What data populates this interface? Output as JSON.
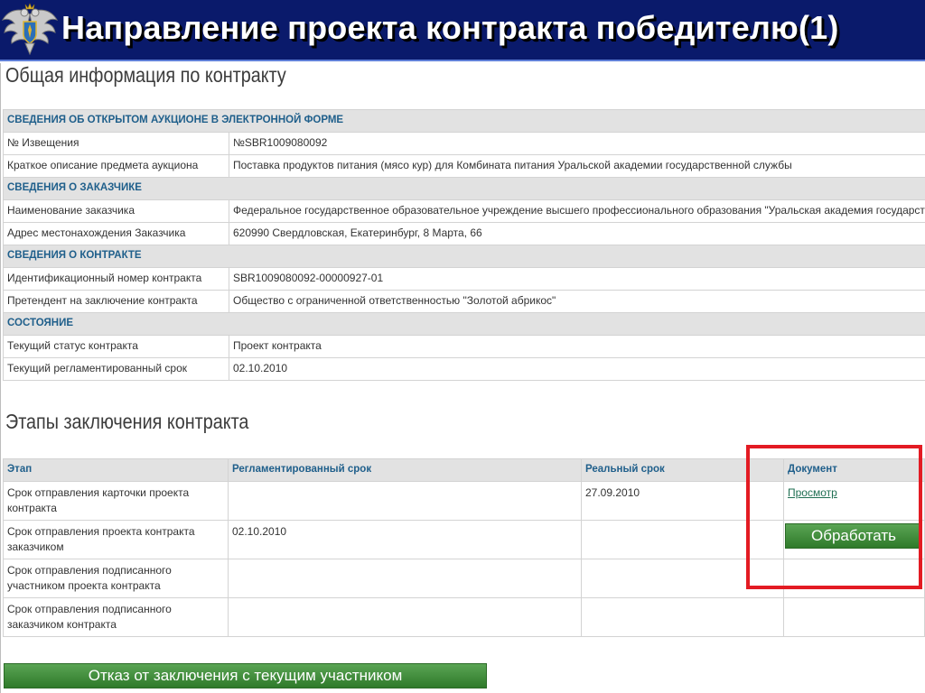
{
  "header": {
    "title": "Направление проекта контракта победителю(1)",
    "emblem_icon": "double-headed-eagle-emblem"
  },
  "general": {
    "heading": "Общая информация по контракту",
    "sections": [
      {
        "title": "СВЕДЕНИЯ ОБ ОТКРЫТОМ АУКЦИОНЕ В ЭЛЕКТРОННОЙ ФОРМЕ",
        "rows": [
          {
            "label": "№ Извещения",
            "value": "№SBR1009080092"
          },
          {
            "label": "Краткое описание предмета аукциона",
            "value": "Поставка продуктов питания (мясо кур) для Комбината питания Уральской академии государственной службы"
          }
        ]
      },
      {
        "title": "СВЕДЕНИЯ О ЗАКАЗЧИКЕ",
        "rows": [
          {
            "label": "Наименование заказчика",
            "value": "Федеральное государственное образовательное учреждение высшего профессионального образования \"Уральская академия государственной"
          },
          {
            "label": "Адрес местонахождения Заказчика",
            "value": "620990 Свердловская, Екатеринбург, 8 Марта, 66"
          }
        ]
      },
      {
        "title": "СВЕДЕНИЯ О КОНТРАКТЕ",
        "rows": [
          {
            "label": "Идентификационный номер контракта",
            "value": "SBR1009080092-00000927-01"
          },
          {
            "label": "Претендент на заключение контракта",
            "value": "Общество с ограниченной ответственностью \"Золотой абрикос\""
          }
        ]
      },
      {
        "title": "СОСТОЯНИЕ",
        "rows": [
          {
            "label": "Текущий статус контракта",
            "value": "Проект контракта"
          },
          {
            "label": "Текущий регламентированный срок",
            "value": "02.10.2010"
          }
        ]
      }
    ]
  },
  "stages": {
    "heading": "Этапы заключения контракта",
    "columns": [
      "Этап",
      "Регламентированный срок",
      "Реальный срок",
      "Документ"
    ],
    "rows": [
      {
        "stage": "Срок отправления карточки проекта контракта",
        "planned": "",
        "actual": "27.09.2010",
        "document": "Просмотр"
      },
      {
        "stage": "Срок отправления проекта контракта заказчиком",
        "planned": "02.10.2010",
        "actual": "",
        "document": ""
      },
      {
        "stage": "Срок отправления подписанного участником проекта контракта",
        "planned": "",
        "actual": "",
        "document": ""
      },
      {
        "stage": "Срок отправления подписанного заказчиком контракта",
        "planned": "",
        "actual": "",
        "document": ""
      }
    ]
  },
  "buttons": {
    "process": "Обработать",
    "refuse": "Отказ от заключения с текущим участником"
  },
  "colors": {
    "header_bg": "#0a1a6b",
    "section_text": "#1f5f8b",
    "button_green": "#3f8b39",
    "highlight_red": "#e31b23"
  }
}
